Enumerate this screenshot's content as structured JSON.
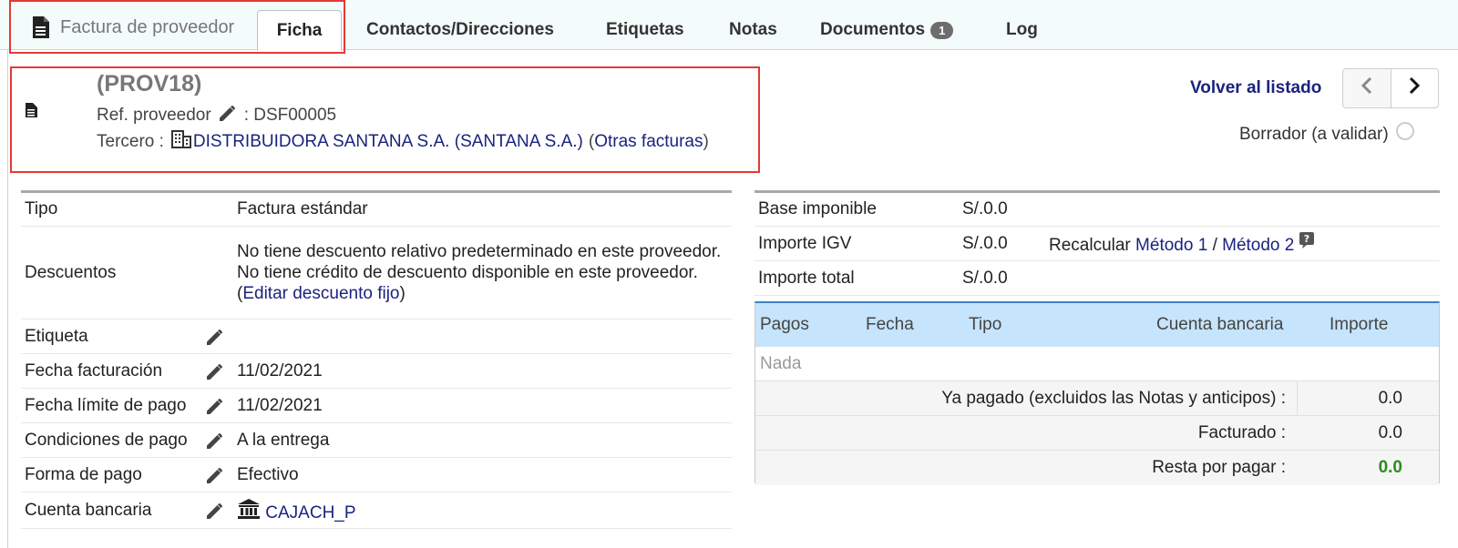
{
  "tabs": {
    "main_label": "Factura de proveedor",
    "active": "Ficha",
    "items": [
      "Contactos/Direcciones",
      "Etiquetas",
      "Notas",
      "Documentos",
      "Log"
    ],
    "documents_count": "1"
  },
  "header": {
    "ref": "(PROV18)",
    "ref_supplier_label": "Ref. proveedor",
    "ref_supplier_value": ": DSF00005",
    "third_party_label": "Tercero :",
    "third_party_name": "DISTRIBUIDORA SANTANA S.A. (SANTANA S.A.)",
    "other_invoices_open": "(",
    "other_invoices_link": "Otras facturas",
    "other_invoices_close": ")",
    "back_link": "Volver al listado",
    "status": "Borrador (a validar)"
  },
  "details": {
    "tipo_label": "Tipo",
    "tipo_value": "Factura estándar",
    "descuentos_label": "Descuentos",
    "descuentos_line1": "No tiene descuento relativo predeterminado en este proveedor.",
    "descuentos_line2": "No tiene crédito de descuento disponible en este proveedor.",
    "descuentos_open": "(",
    "descuentos_link": "Editar descuento fijo",
    "descuentos_close": ")",
    "etiqueta_label": "Etiqueta",
    "etiqueta_value": "",
    "fecha_fact_label": "Fecha facturación",
    "fecha_fact_value": "11/02/2021",
    "fecha_lim_label": "Fecha límite de pago",
    "fecha_lim_value": "11/02/2021",
    "condiciones_label": "Condiciones de pago",
    "condiciones_value": "A la entrega",
    "forma_label": "Forma de pago",
    "forma_value": "Efectivo",
    "cuenta_label": "Cuenta bancaria",
    "cuenta_value": "CAJACH_P"
  },
  "totals": {
    "base_label": "Base imponible",
    "base_value": "S/.0.0",
    "igv_label": "Importe IGV",
    "igv_value": "S/.0.0",
    "recalc_label": "Recalcular",
    "method1": "Método 1",
    "sep": "/",
    "method2": "Método 2",
    "total_label": "Importe total",
    "total_value": "S/.0.0"
  },
  "payments": {
    "headers": [
      "Pagos",
      "Fecha",
      "Tipo",
      "Cuenta bancaria",
      "Importe"
    ],
    "empty": "Nada",
    "paid_label": "Ya pagado (excluidos las Notas y anticipos) :",
    "paid_value": "0.0",
    "billed_label": "Facturado :",
    "billed_value": "0.0",
    "remaining_label": "Resta por pagar :",
    "remaining_value": "0.0"
  },
  "colors": {
    "link": "#1a237e",
    "highlight": "#e53935",
    "remaining": "#2e8b1f",
    "payments_header": "#c6e4fb"
  }
}
